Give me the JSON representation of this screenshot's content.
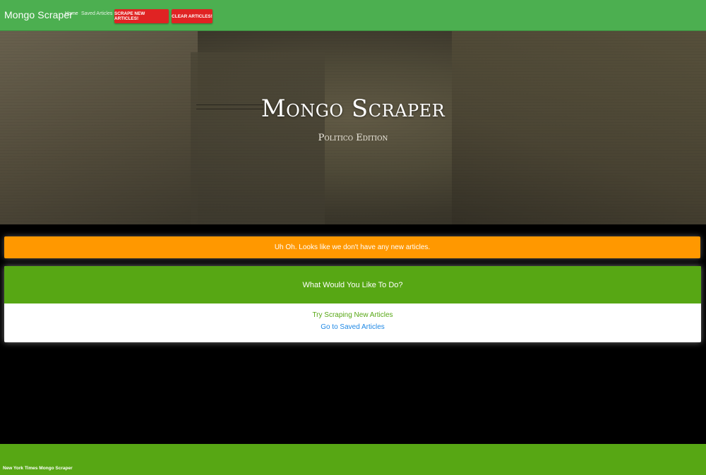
{
  "navbar": {
    "brand": "Mongo Scraper",
    "links": [
      {
        "label": "Home"
      },
      {
        "label": "Saved Articles"
      }
    ],
    "buttons": {
      "scrape_label": "SCRAPE NEW ARTICLES!",
      "clear_label": "CLEAR ARTICLES!"
    },
    "color": "#4caf50"
  },
  "hero": {
    "title": "Mongo Scraper",
    "subtitle": "Politico Edition"
  },
  "alert": {
    "message": "Uh Oh. Looks like we don't have any new articles.",
    "color": "#ff9800"
  },
  "card": {
    "header": "What Would You Like To Do?",
    "scrape_link": "Try Scraping New Articles",
    "saved_link": "Go to Saved Articles",
    "header_color": "#57a714"
  },
  "footer": {
    "text": "New York Times Mongo Scraper"
  }
}
